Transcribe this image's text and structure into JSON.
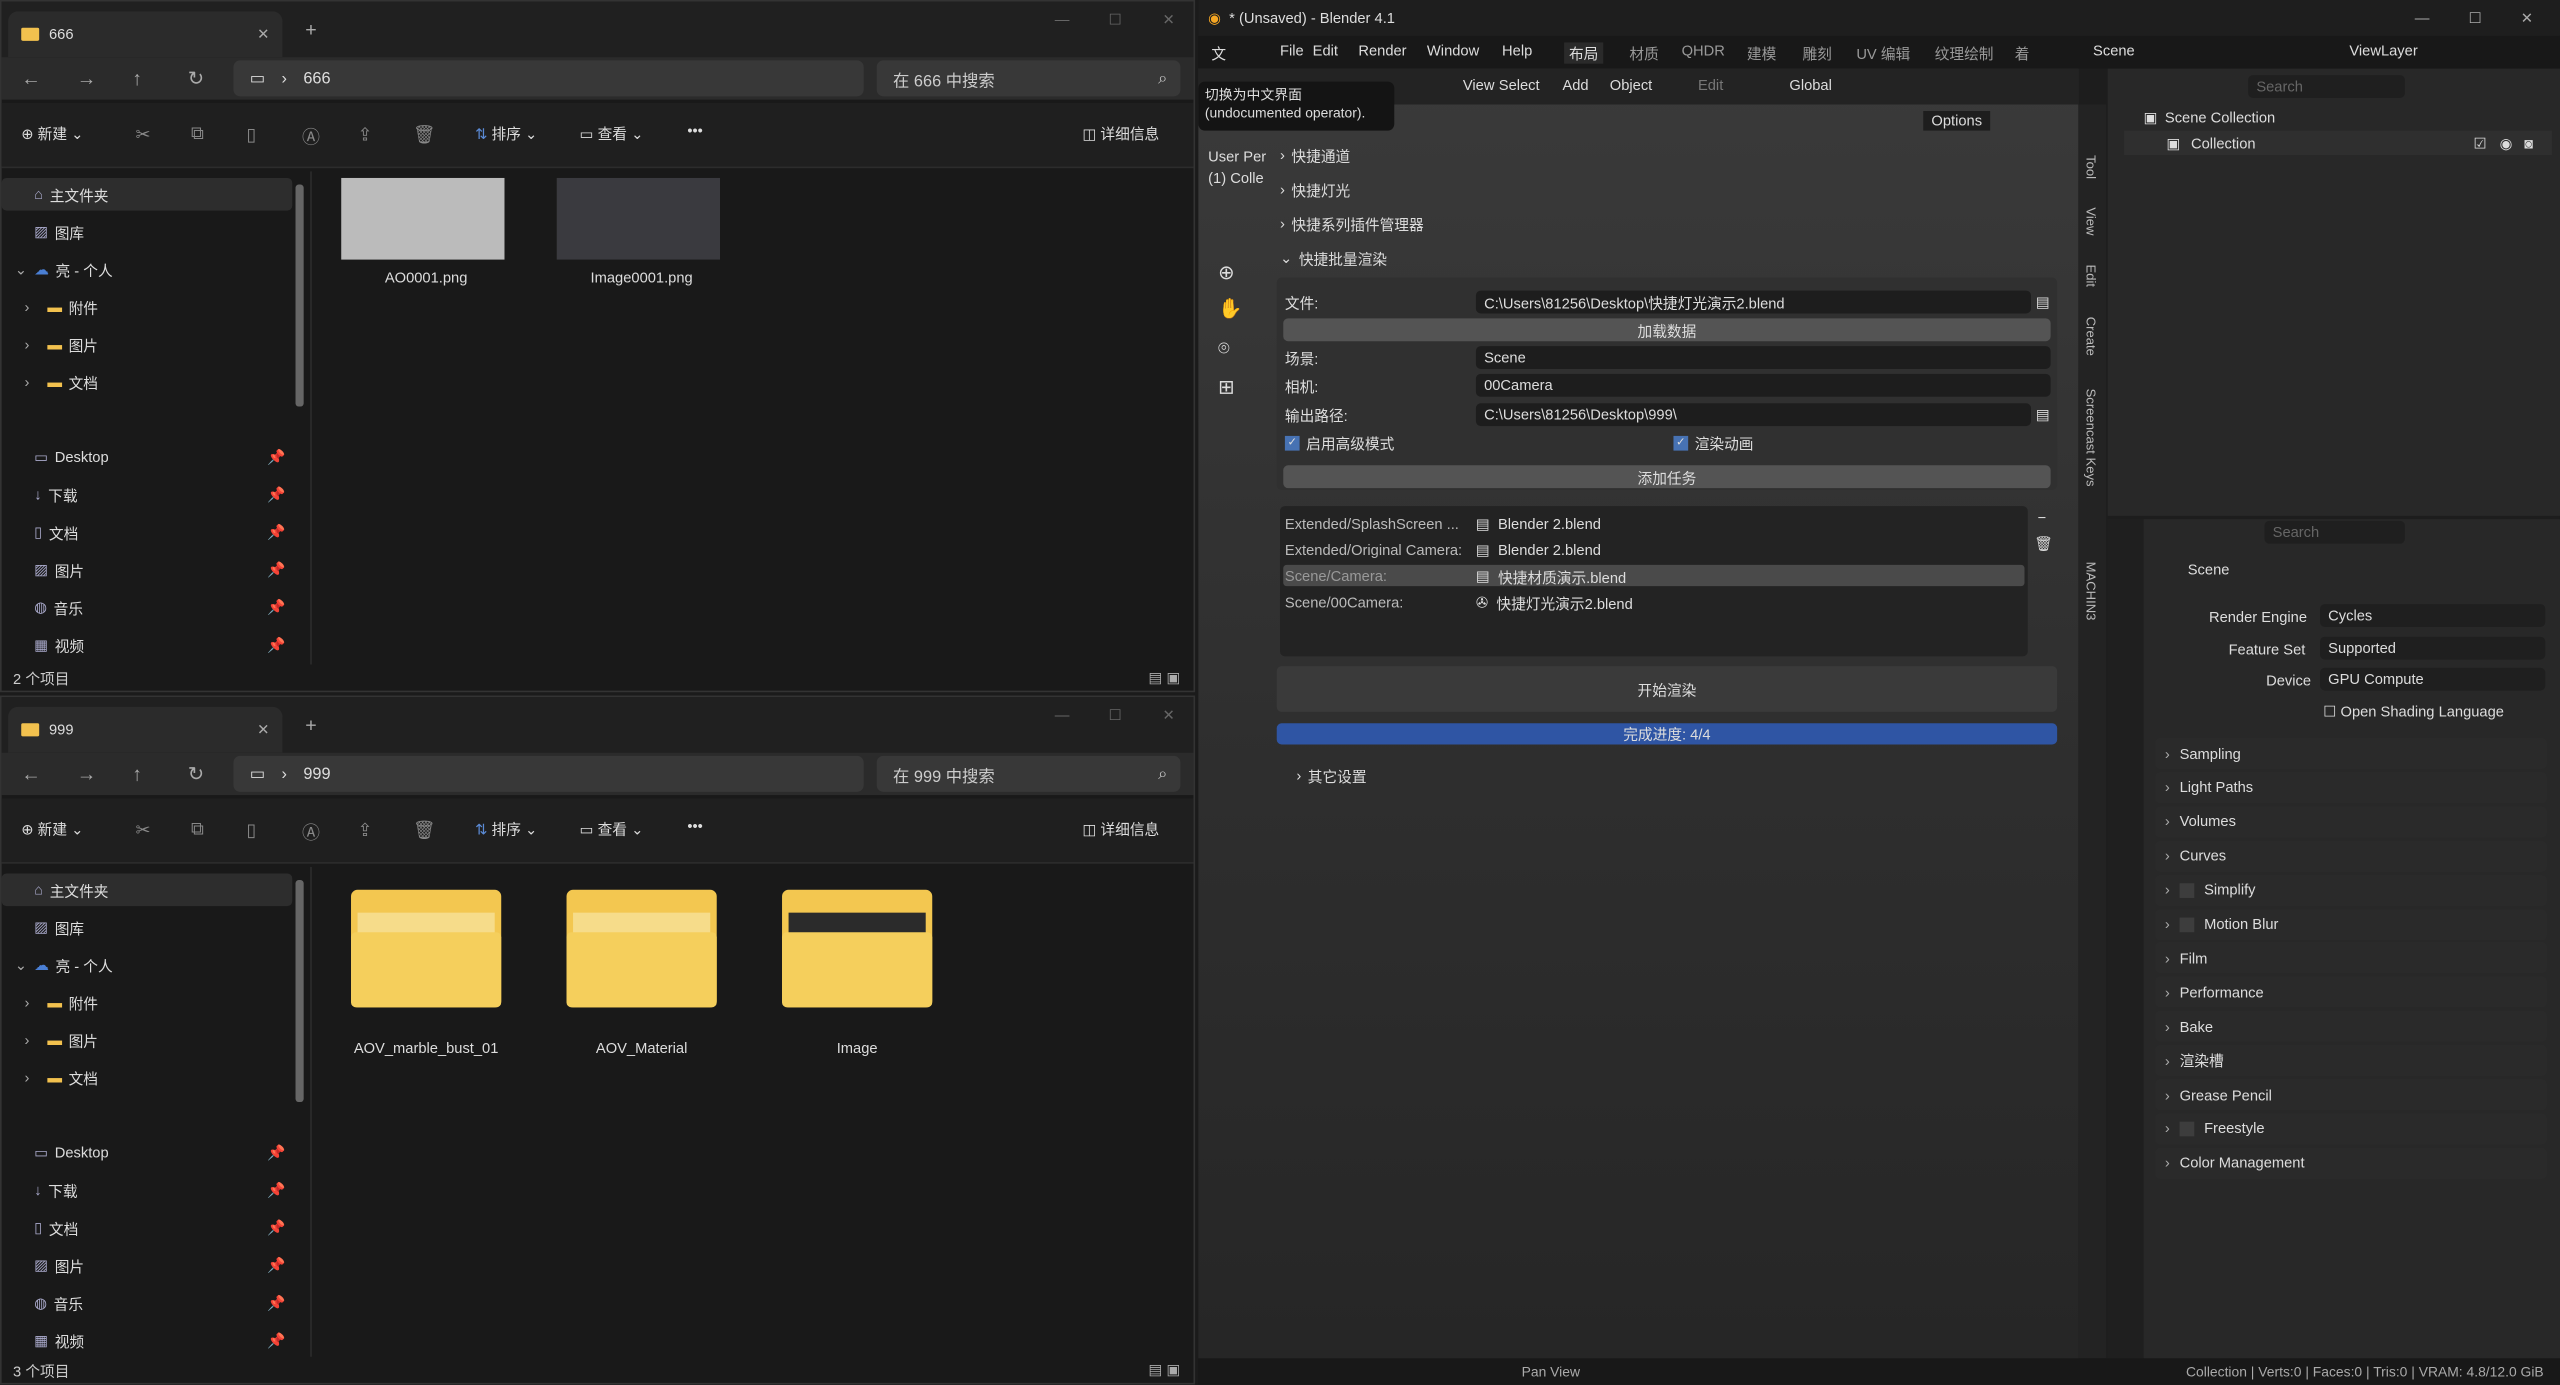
{
  "explorer_top": {
    "tab": "666",
    "path": "666",
    "search": "在 666 中搜索",
    "toolbar": {
      "new": "新建",
      "sort": "排序",
      "view": "查看",
      "more": "•••",
      "details": "详细信息"
    },
    "sidebar": [
      "主文件夹",
      "图库",
      "亮 - 个人",
      "附件",
      "图片",
      "文档",
      "Desktop",
      "下载",
      "文档",
      "图片",
      "音乐",
      "视频"
    ],
    "files": [
      "AO0001.png",
      "Image0001.png"
    ],
    "status": "2 个项目"
  },
  "explorer_bottom": {
    "tab": "999",
    "path": "999",
    "search": "在 999 中搜索",
    "toolbar": {
      "new": "新建",
      "sort": "排序",
      "view": "查看",
      "more": "•••",
      "details": "详细信息"
    },
    "sidebar": [
      "主文件夹",
      "图库",
      "亮 - 个人",
      "附件",
      "图片",
      "文档",
      "Desktop",
      "下载",
      "文档",
      "图片",
      "音乐",
      "视频"
    ],
    "files": [
      "AOV_marble_bust_01",
      "AOV_Material",
      "Image"
    ],
    "status": "3 个项目"
  },
  "blender": {
    "title": "* (Unsaved) - Blender 4.1",
    "menu": [
      "File",
      "Edit",
      "Render",
      "Window",
      "Help"
    ],
    "workspaces": [
      "布局",
      "材质",
      "QHDR",
      "建模",
      "雕刻",
      "UV 编辑",
      "纹理绘制",
      "着"
    ],
    "scene": "Scene",
    "view_layer": "ViewLayer",
    "header": [
      "View",
      "Select",
      "Add",
      "Object",
      "Edit",
      "Global"
    ],
    "tooltip": [
      "切换为中文界面",
      "(undocumented operator)."
    ],
    "options": "Options",
    "viewport_info": [
      "User Per",
      "(1) Colle"
    ],
    "panel": {
      "sections": [
        "快捷通道",
        "快捷灯光",
        "快捷系列插件管理器",
        "快捷批量渲染"
      ],
      "file_label": "文件:",
      "file_value": "C:\\Users\\81256\\Desktop\\快捷灯光演示2.blend",
      "load_data": "加载数据",
      "scene_label": "场景:",
      "scene_value": "Scene",
      "camera_label": "相机:",
      "camera_value": "00Camera",
      "output_label": "输出路径:",
      "output_value": "C:\\Users\\81256\\Desktop\\999\\",
      "advanced": "启用高级模式",
      "animation": "渲染动画",
      "add_task": "添加任务",
      "tasks": [
        {
          "name": "Extended/SplashScreen ...",
          "file": "Blender 2.blend"
        },
        {
          "name": "Extended/Original Camera:",
          "file": "Blender 2.blend"
        },
        {
          "name": "Scene/Camera:",
          "file": "快捷材质演示.blend"
        },
        {
          "name": "Scene/00Camera:",
          "file": "快捷灯光演示2.blend"
        }
      ],
      "start_render": "开始渲染",
      "progress_text": "完成进度: 4/4",
      "progress": 1.0,
      "other": "其它设置"
    },
    "side_tabs": [
      "Tool",
      "View",
      "Edit",
      "Create",
      "Screencast Keys",
      "MACHIN3"
    ],
    "outliner": {
      "search": "Search",
      "items": [
        "Scene Collection",
        "Collection"
      ]
    },
    "properties": {
      "search": "Search",
      "scene": "Scene",
      "render_engine_label": "Render Engine",
      "render_engine": "Cycles",
      "feature_set_label": "Feature Set",
      "feature_set": "Supported",
      "device_label": "Device",
      "device": "GPU Compute",
      "osl": "Open Shading Language",
      "panels": [
        "Sampling",
        "Light Paths",
        "Volumes",
        "Curves",
        "Simplify",
        "Motion Blur",
        "Film",
        "Performance",
        "Bake",
        "渲染槽",
        "Grease Pencil",
        "Freestyle",
        "Color Management"
      ]
    },
    "status": {
      "pan": "Pan View",
      "stats": "Collection | Verts:0 | Faces:0 | Tris:0 | VRAM: 4.8/12.0 GiB"
    },
    "colors": {
      "accent": "#2f55a4",
      "bg": "#1d1d1d"
    }
  }
}
